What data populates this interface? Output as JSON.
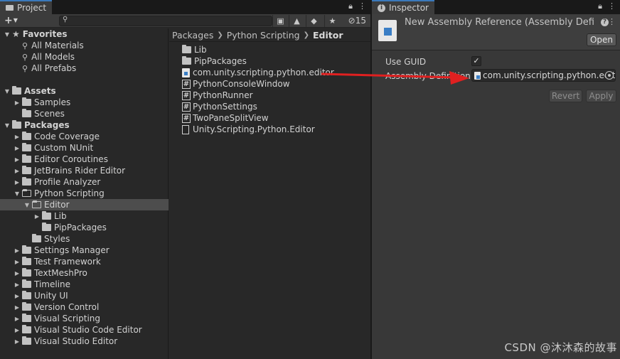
{
  "project": {
    "tab_label": "Project",
    "hidden_count": "15",
    "tree": [
      {
        "label": "Favorites",
        "indent": 0,
        "expander": "open",
        "icon": "star",
        "head": true
      },
      {
        "label": "All Materials",
        "indent": 1,
        "expander": "",
        "icon": "search"
      },
      {
        "label": "All Models",
        "indent": 1,
        "expander": "",
        "icon": "search"
      },
      {
        "label": "All Prefabs",
        "indent": 1,
        "expander": "",
        "icon": "search"
      },
      {
        "label": "",
        "indent": 0,
        "expander": "",
        "icon": ""
      },
      {
        "label": "Assets",
        "indent": 0,
        "expander": "open",
        "icon": "folder",
        "head": true
      },
      {
        "label": "Samples",
        "indent": 1,
        "expander": "closed",
        "icon": "folder"
      },
      {
        "label": "Scenes",
        "indent": 1,
        "expander": "",
        "icon": "folder"
      },
      {
        "label": "Packages",
        "indent": 0,
        "expander": "open",
        "icon": "folder",
        "head": true
      },
      {
        "label": "Code Coverage",
        "indent": 1,
        "expander": "closed",
        "icon": "folder"
      },
      {
        "label": "Custom NUnit",
        "indent": 1,
        "expander": "closed",
        "icon": "folder"
      },
      {
        "label": "Editor Coroutines",
        "indent": 1,
        "expander": "closed",
        "icon": "folder"
      },
      {
        "label": "JetBrains Rider Editor",
        "indent": 1,
        "expander": "closed",
        "icon": "folder"
      },
      {
        "label": "Profile Analyzer",
        "indent": 1,
        "expander": "closed",
        "icon": "folder"
      },
      {
        "label": "Python Scripting",
        "indent": 1,
        "expander": "open",
        "icon": "folder-open"
      },
      {
        "label": "Editor",
        "indent": 2,
        "expander": "open",
        "icon": "folder-open",
        "selected": true
      },
      {
        "label": "Lib",
        "indent": 3,
        "expander": "closed",
        "icon": "folder"
      },
      {
        "label": "PipPackages",
        "indent": 3,
        "expander": "",
        "icon": "folder"
      },
      {
        "label": "Styles",
        "indent": 2,
        "expander": "",
        "icon": "folder"
      },
      {
        "label": "Settings Manager",
        "indent": 1,
        "expander": "closed",
        "icon": "folder"
      },
      {
        "label": "Test Framework",
        "indent": 1,
        "expander": "closed",
        "icon": "folder"
      },
      {
        "label": "TextMeshPro",
        "indent": 1,
        "expander": "closed",
        "icon": "folder"
      },
      {
        "label": "Timeline",
        "indent": 1,
        "expander": "closed",
        "icon": "folder"
      },
      {
        "label": "Unity UI",
        "indent": 1,
        "expander": "closed",
        "icon": "folder"
      },
      {
        "label": "Version Control",
        "indent": 1,
        "expander": "closed",
        "icon": "folder"
      },
      {
        "label": "Visual Scripting",
        "indent": 1,
        "expander": "closed",
        "icon": "folder"
      },
      {
        "label": "Visual Studio Code Editor",
        "indent": 1,
        "expander": "closed",
        "icon": "folder"
      },
      {
        "label": "Visual Studio Editor",
        "indent": 1,
        "expander": "closed",
        "icon": "folder"
      }
    ],
    "breadcrumb": [
      "Packages",
      "Python Scripting",
      "Editor"
    ],
    "files": [
      {
        "label": "Lib",
        "icon": "folder"
      },
      {
        "label": "PipPackages",
        "icon": "folder"
      },
      {
        "label": "com.unity.scripting.python.editor",
        "icon": "assembly"
      },
      {
        "label": "PythonConsoleWindow",
        "icon": "csharp"
      },
      {
        "label": "PythonRunner",
        "icon": "csharp"
      },
      {
        "label": "PythonSettings",
        "icon": "csharp"
      },
      {
        "label": "TwoPaneSplitView",
        "icon": "csharp"
      },
      {
        "label": "Unity.Scripting.Python.Editor",
        "icon": "document"
      }
    ]
  },
  "inspector": {
    "tab_label": "Inspector",
    "title": "New Assembly Reference (Assembly Defir",
    "open_label": "Open",
    "use_guid_label": "Use GUID",
    "use_guid_checked": "✓",
    "assembly_def_label": "Assembly Definition",
    "assembly_def_value": "com.unity.scripting.python.edit",
    "revert_label": "Revert",
    "apply_label": "Apply"
  },
  "annotation": {
    "color": "#e02020"
  },
  "watermark": "CSDN @沐沐森的故事"
}
